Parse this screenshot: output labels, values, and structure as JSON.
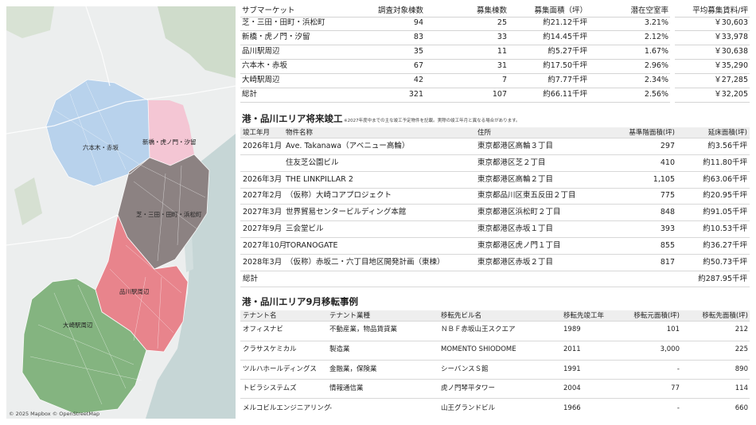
{
  "map": {
    "labels": {
      "roppongi": "六本木・赤坂",
      "shinbashi": "新橋・虎ノ門・汐留",
      "shiba": "芝・三田・田町・浜松町",
      "shinagawa": "品川駅周辺",
      "osaki": "大崎駅周辺"
    },
    "credit": "© 2025 Mapbox © OpenStreetMap",
    "colors": {
      "roppongi": "#b8d2ec",
      "shinbashi": "#f4c6d4",
      "shiba": "#8c8282",
      "shinagawa": "#e8848c",
      "osaki": "#84b480",
      "water": "#c6d6d6",
      "park": "#cfdccb",
      "land": "#eceeee"
    }
  },
  "summary": {
    "headers": [
      "サブマーケット",
      "調査対象棟数",
      "募集棟数",
      "募集面積（坪）",
      "潜在空室率",
      "平均募集賃料/坪"
    ],
    "rows": [
      [
        "芝・三田・田町・浜松町",
        "94",
        "25",
        "約21.12千坪",
        "3.21%",
        "￥30,603"
      ],
      [
        "新橋・虎ノ門・汐留",
        "83",
        "33",
        "約14.45千坪",
        "2.12%",
        "￥33,978"
      ],
      [
        "品川駅周辺",
        "35",
        "11",
        "約5.27千坪",
        "1.67%",
        "￥30,638"
      ],
      [
        "六本木・赤坂",
        "67",
        "31",
        "約17.50千坪",
        "2.96%",
        "￥35,290"
      ],
      [
        "大崎駅周辺",
        "42",
        "7",
        "約7.77千坪",
        "2.34%",
        "￥27,285"
      ],
      [
        "総計",
        "321",
        "107",
        "約66.11千坪",
        "2.56%",
        "￥32,205"
      ]
    ]
  },
  "construction": {
    "title": "港・品川エリア将来竣工",
    "note": "※2027年度中までの主な竣工予定物件を記載。実際の竣工年月と異なる場合があります。",
    "headers": [
      "竣工年月",
      "物件名称",
      "住所",
      "基準階面積(坪)",
      "延床面積(坪)"
    ],
    "rows": [
      [
        "2026年1月",
        "Ave. Takanawa（アベニュー高輪）",
        "東京都港区高輪３丁目",
        "297",
        "約3.56千坪"
      ],
      [
        "",
        "住友芝公園ビル",
        "東京都港区芝２丁目",
        "410",
        "約11.80千坪"
      ],
      [
        "2026年3月",
        "THE LINKPILLAR 2",
        "東京都港区高輪２丁目",
        "1,105",
        "約63.06千坪"
      ],
      [
        "2027年2月",
        "（仮称）大崎コアプロジェクト",
        "東京都品川区東五反田２丁目",
        "775",
        "約20.95千坪"
      ],
      [
        "2027年3月",
        "世界貿易センタービルディング本館",
        "東京都港区浜松町２丁目",
        "848",
        "約91.05千坪"
      ],
      [
        "2027年9月",
        "三会堂ビル",
        "東京都港区赤坂１丁目",
        "393",
        "約10.53千坪"
      ],
      [
        "2027年10月",
        "TORANOGATE",
        "東京都港区虎ノ門１丁目",
        "855",
        "約36.27千坪"
      ],
      [
        "2028年3月",
        "（仮称）赤坂二・六丁目地区開発計画（東棟）",
        "東京都港区赤坂２丁目",
        "817",
        "約50.73千坪"
      ]
    ],
    "total_label": "総計",
    "total_value": "約287.95千坪"
  },
  "relocation": {
    "title": "港・品川エリア9月移転事例",
    "headers": [
      "テナント名",
      "テナント業種",
      "移転先ビル名",
      "移転先竣工年",
      "移転元面積(坪)",
      "移転先面積(坪)"
    ],
    "rows": [
      [
        "オフィスナビ",
        "不動産業，物品賃貸業",
        "ＮＢＦ赤坂山王スクエア",
        "1989",
        "101",
        "212"
      ],
      [
        "クラサスケミカル",
        "製造業",
        "MOMENTO SHIODOME",
        "2011",
        "3,000",
        "225"
      ],
      [
        "ツルハホールディングス",
        "金融業，保険業",
        "シーバンスＳ館",
        "1991",
        "-",
        "890"
      ],
      [
        "トビラシステムズ",
        "情報通信業",
        "虎ノ門琴平タワー",
        "2004",
        "77",
        "114"
      ],
      [
        "メルコビルエンジニアリング",
        "-",
        "山王グランドビル",
        "1966",
        "-",
        "660"
      ]
    ]
  }
}
